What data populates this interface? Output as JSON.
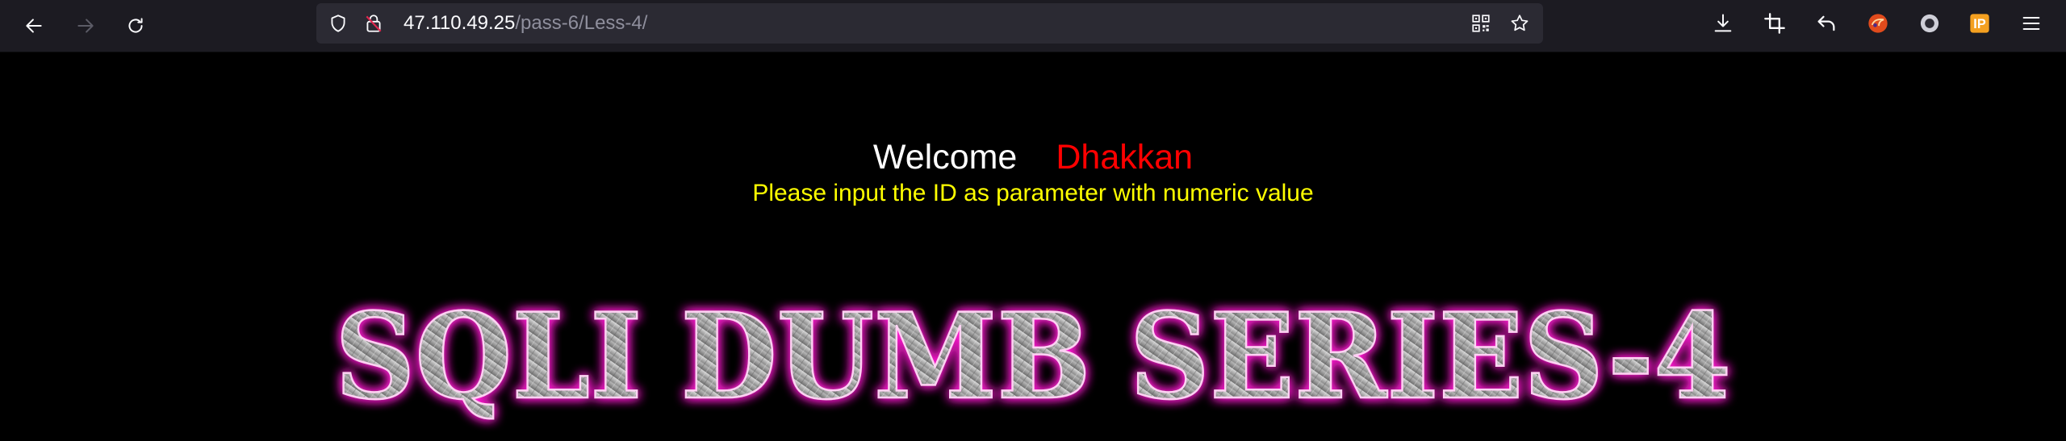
{
  "browser": {
    "url_host": "47.110.49.25",
    "url_path": "/pass-6/Less-4/",
    "icons": {
      "back": "arrow-left-icon",
      "forward": "arrow-right-icon",
      "reload": "reload-icon",
      "shield": "shield-icon",
      "insecure": "insecure-lock-icon",
      "qr": "qr-code-icon",
      "bookmark": "star-icon",
      "download": "download-icon",
      "screenshot": "crop-icon",
      "undo": "undo-icon",
      "hackbar": "hackbar-extension-icon",
      "circle": "circle-extension-icon",
      "ip": "ip-extension-icon",
      "menu": "hamburger-menu-icon"
    },
    "ip_badge_text": "IP"
  },
  "page": {
    "welcome": "Welcome",
    "name": "Dhakkan",
    "instruction": "Please input the ID as parameter with numeric value",
    "banner_text": "SQLI DUMB SERIES-4",
    "colors": {
      "background": "#000000",
      "welcome": "#ffffff",
      "name": "#ff0000",
      "instruction": "#ffff00",
      "banner_glow": "#ff1fd2",
      "banner_fill": "#9a9a9a"
    }
  }
}
